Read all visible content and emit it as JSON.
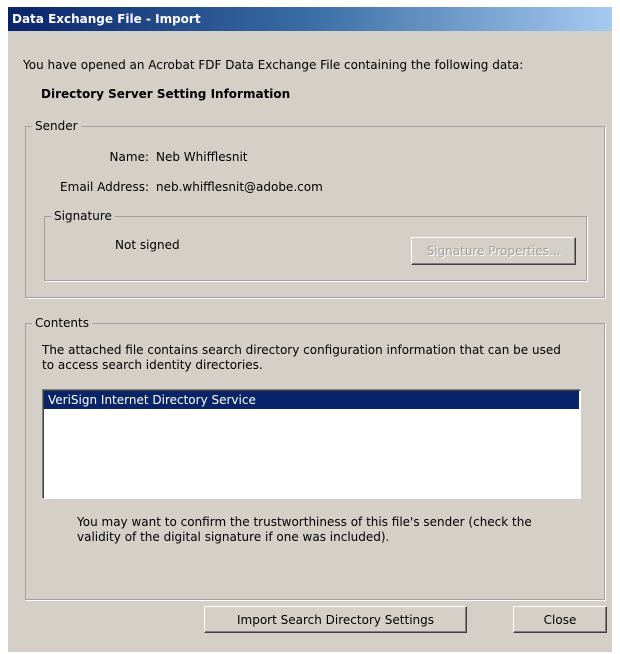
{
  "window": {
    "title": "Data Exchange File - Import"
  },
  "intro_text": "You have opened an Acrobat FDF Data Exchange File containing the following data:",
  "data_title": "Directory Server Setting Information",
  "sender": {
    "legend": "Sender",
    "name_label": "Name:",
    "name_value": "Neb Whifflesnit",
    "email_label": "Email Address:",
    "email_value": "neb.whifflesnit@adobe.com",
    "signature": {
      "legend": "Signature",
      "status": "Not signed",
      "properties_button": "Signature Properties..."
    }
  },
  "contents": {
    "legend": "Contents",
    "description": "The attached file contains search directory configuration information that can be used",
    "description_line2": "to access search identity directories.",
    "items": [
      {
        "label": "VeriSign Internet Directory Service",
        "selected": true
      }
    ],
    "note_line1": "You may want to confirm the trustworthiness of this file's sender (check the",
    "note_line2": "validity of the digital signature if one was included)."
  },
  "buttons": {
    "import": "Import Search Directory Settings",
    "close": "Close"
  },
  "colors": {
    "dialog_bg": "#d4d0c8",
    "titlebar_start": "#0a246a",
    "titlebar_end": "#a6caf0",
    "selection_bg": "#0a246a",
    "disabled_text": "#a0a0a0"
  }
}
